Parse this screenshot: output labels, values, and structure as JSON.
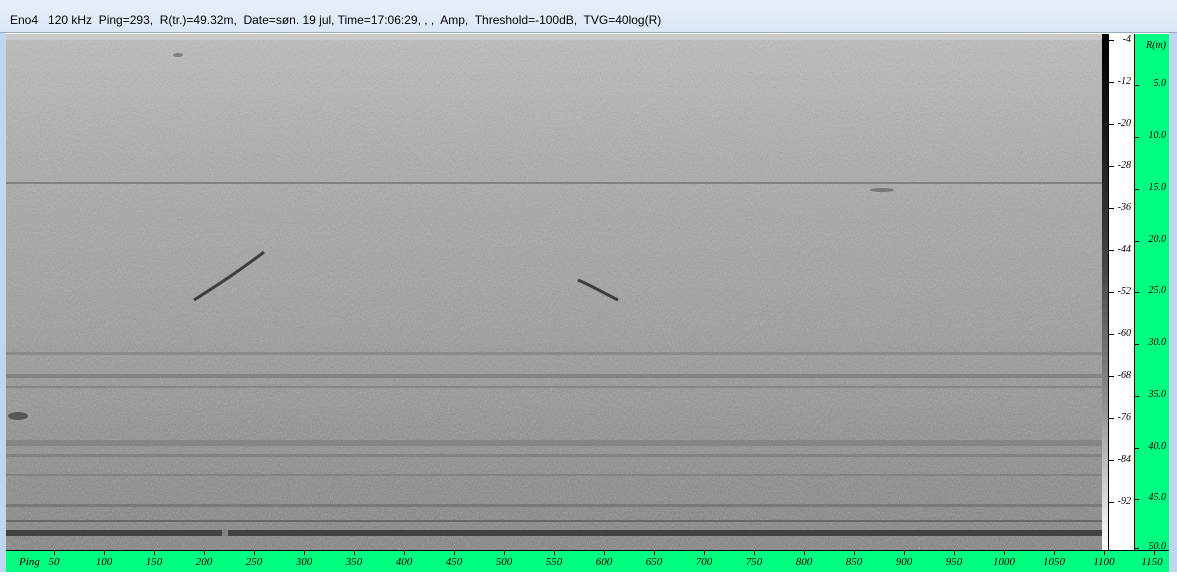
{
  "window": {
    "title": "Eno4   120 kHz  Ping=293,  R(tr.)=49.32m,  Date=søn. 19 jul, Time=17:06:29, , ,  Amp,  Threshold=-100dB,  TVG=40log(R)"
  },
  "amplitude_scale": {
    "labels": [
      "-4",
      "-12",
      "-20",
      "-28",
      "-36",
      "-44",
      "-52",
      "-60",
      "-68",
      "-76",
      "-84",
      "-92"
    ]
  },
  "range_axis": {
    "title": "R(m)",
    "labels": [
      "5.0",
      "10.0",
      "15.0",
      "20.0",
      "25.0",
      "30.0",
      "35.0",
      "40.0",
      "45.0",
      "50.0"
    ]
  },
  "ping_axis": {
    "title": "Ping",
    "labels": [
      "50",
      "100",
      "150",
      "200",
      "250",
      "300",
      "350",
      "400",
      "450",
      "500",
      "550",
      "600",
      "650",
      "700",
      "750",
      "800",
      "850",
      "900",
      "950",
      "1000",
      "1050",
      "1100",
      "1150"
    ]
  },
  "colors": {
    "axis_bg": "#00ff80",
    "frame": "#bfd7ee"
  }
}
